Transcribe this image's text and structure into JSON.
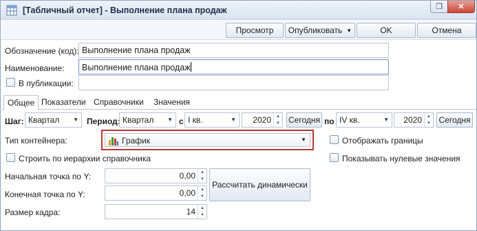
{
  "window": {
    "title": "[Табличный отчет] - Выполнение плана продаж",
    "restore_glyph": "❐",
    "close_glyph": "✕"
  },
  "toolbar": {
    "preview": "Просмотр",
    "publish": "Опубликовать",
    "ok": "OK",
    "cancel": "Отмена"
  },
  "form": {
    "code_label": "Обозначение (код):",
    "code_value": "Выполнение плана продаж",
    "name_label": "Наименование:",
    "name_value": "Выполнение плана продаж",
    "in_publication_label": "В публикации:",
    "in_publication_value": "",
    "in_publication_checked": false
  },
  "tabs": [
    {
      "label": "Общее",
      "active": true
    },
    {
      "label": "Показатели",
      "active": false
    },
    {
      "label": "Справочники",
      "active": false
    },
    {
      "label": "Значения",
      "active": false
    }
  ],
  "period_row": {
    "step_label": "Шаг:",
    "step_value": "Квартал",
    "period_label": "Период:",
    "period_value": "Квартал",
    "from_label": "с",
    "from_quarter": "I кв.",
    "from_year": "2020",
    "today_label": "Сегодня",
    "to_label": "по",
    "to_quarter": "IV кв.",
    "to_year": "2020"
  },
  "general": {
    "container_type_label": "Тип контейнера:",
    "container_type_value": "График",
    "show_borders_label": "Отображать границы",
    "show_borders_checked": false,
    "build_hierarchy_label": "Строить по иерархии справочника",
    "build_hierarchy_checked": false,
    "show_zero_label": "Показывать нулевые значения",
    "show_zero_checked": false,
    "start_y_label": "Начальная точка по Y:",
    "start_y_value": "0,00",
    "end_y_label": "Конечная точка по Y:",
    "end_y_value": "0,00",
    "frame_size_label": "Размер кадра:",
    "frame_size_value": "14",
    "calc_dynamic_label": "Рассчитать динамически"
  },
  "colors": {
    "highlight": "#b9362e",
    "titlebar": "#dbe4f0",
    "close_button": "#c7493a"
  },
  "icons": {
    "app": "report-table-icon",
    "container": "bar-chart-icon"
  }
}
